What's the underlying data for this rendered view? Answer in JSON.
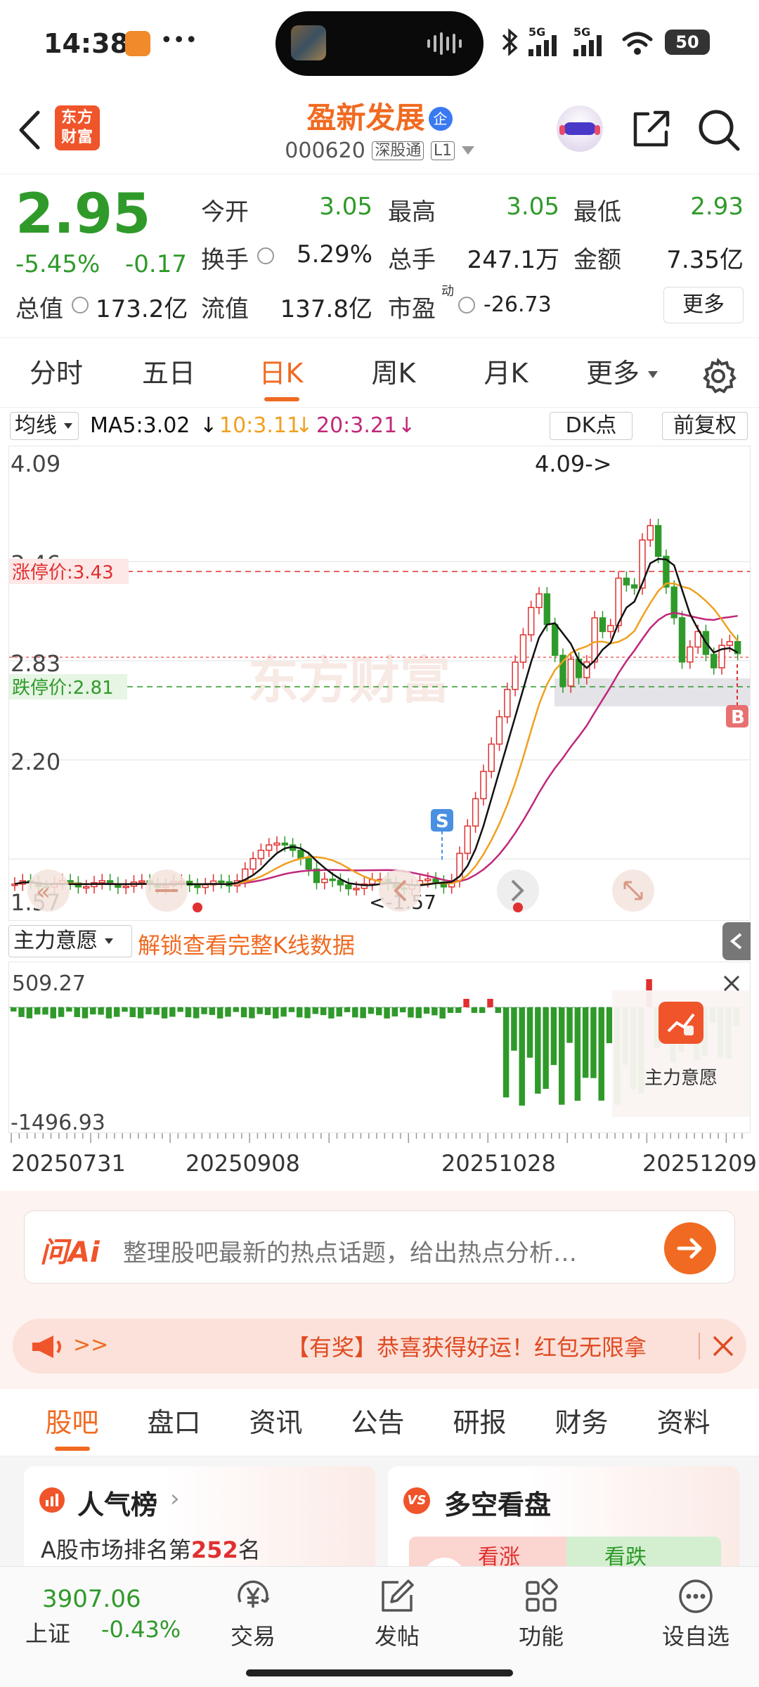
{
  "status_bar": {
    "time": "14:38",
    "dots": "•••",
    "network1": "5G",
    "network2": "5G",
    "battery": "50"
  },
  "header": {
    "logo_text": "东方财富",
    "stock_name": "盈新发展",
    "enterprise_badge": "企",
    "stock_code": "000620",
    "tag1": "深股通",
    "tag2": "L1"
  },
  "quote": {
    "price": "2.95",
    "change_pct": "-5.45%",
    "change_amt": "-0.17",
    "open_label": "今开",
    "open": "3.05",
    "high_label": "最高",
    "high": "3.05",
    "low_label": "最低",
    "low": "2.93",
    "turnover_label": "换手",
    "turnover": "5.29%",
    "volume_label": "总手",
    "volume": "247.1万",
    "amount_label": "金额",
    "amount": "7.35亿",
    "mcap_label": "总值",
    "mcap": "173.2亿",
    "float_label": "流值",
    "float": "137.8亿",
    "pe_label": "市盈",
    "pe_sup": "动",
    "pe": "-26.73",
    "more_btn": "更多"
  },
  "tabs": {
    "items": [
      "分时",
      "五日",
      "日K",
      "周K",
      "月K",
      "更多"
    ],
    "active": 2
  },
  "ma_bar": {
    "avg_label": "均线",
    "ma5": "MA5:3.02",
    "ma10": "10:3.11",
    "ma20": "20:3.21",
    "dk": "DK点",
    "adj": "前复权",
    "arrow": "↓"
  },
  "kline": {
    "y_labels": [
      "4.09",
      "3.46",
      "2.83",
      "2.20",
      "1.57"
    ],
    "limit_up": "涨停价:3.43",
    "limit_down": "跌停价:2.81",
    "max_note": "4.09->",
    "min_note": "<-1.57",
    "s_mark": "S",
    "b_mark": "B",
    "watermark": "东方财富"
  },
  "indicator": {
    "name": "主力意愿",
    "unlock": "解锁查看完整K线数据",
    "top": "509.27",
    "bottom": "-1496.93",
    "promo": "主力意愿"
  },
  "dates": [
    "20250731",
    "20250908",
    "20251028",
    "20251209"
  ],
  "ai_box": {
    "brand": "问Ai",
    "placeholder": "整理股吧最新的热点话题，给出热点分析…"
  },
  "notice": {
    "arrows": ">>",
    "text": "【有奖】恭喜获得好运！红包无限拿"
  },
  "section_tabs": {
    "items": [
      "股吧",
      "盘口",
      "资讯",
      "公告",
      "研报",
      "财务",
      "资料"
    ],
    "active": 0
  },
  "cards": {
    "popularity_title": "人气榜",
    "popularity_text": "A股市场排名第",
    "rank": "252",
    "rank_unit": "名",
    "vs_title": "多空看盘",
    "bull": "看涨",
    "bear": "看跌"
  },
  "bottom_nav": {
    "index_value": "3907.06",
    "index_name": "上证",
    "index_change": "-0.43%",
    "items": [
      "交易",
      "发帖",
      "功能",
      "设自选"
    ]
  },
  "colors": {
    "up": "#e03030",
    "down": "#2f9a2a",
    "brand": "#f06a21",
    "ma5": "#111111",
    "ma10": "#f0a020",
    "ma20": "#c0287a"
  }
}
